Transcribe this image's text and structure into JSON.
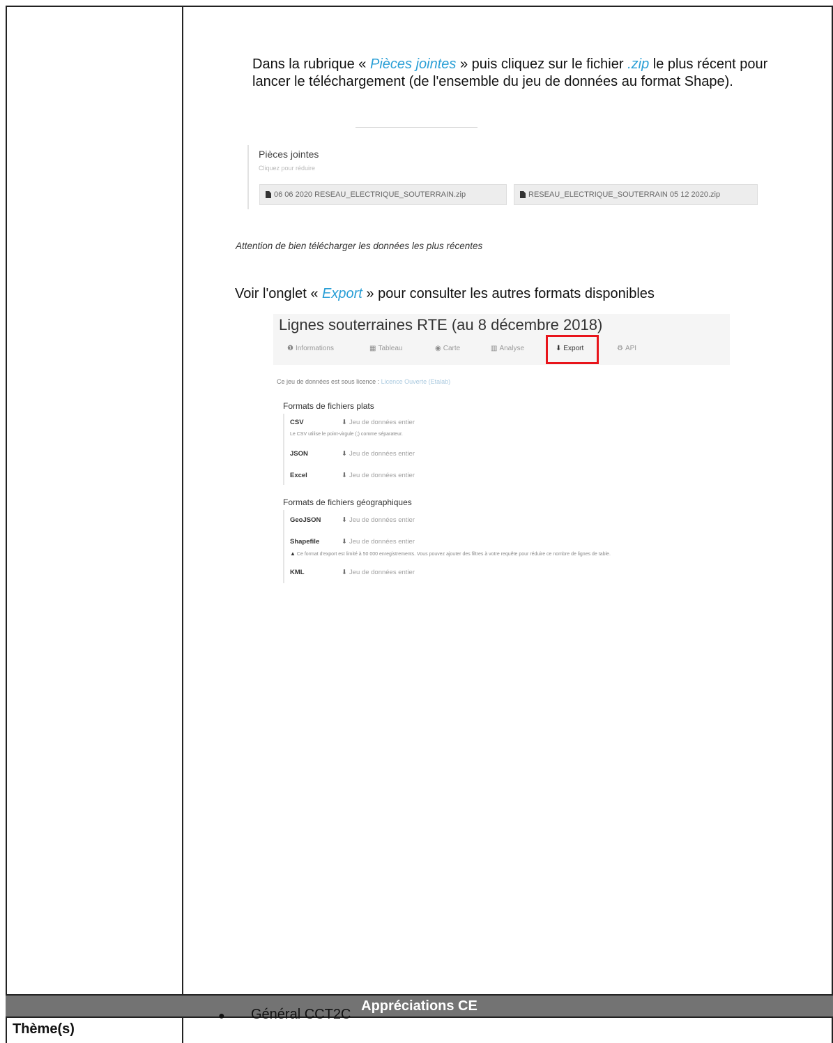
{
  "intro": {
    "part1": "Dans la rubrique « ",
    "pieces": "Pièces jointes",
    "part2": " » puis cliquez sur le fichier ",
    "zip": ".zip",
    "part3": " le plus récent pour lancer le téléchargement (de l'ensemble du jeu de données au format Shape)."
  },
  "attachments": {
    "title": "Pièces jointes",
    "subtitle": "Cliquez pour réduire",
    "files": [
      "06 06 2020 RESEAU_ELECTRIQUE_SOUTERRAIN.zip",
      "RESEAU_ELECTRIQUE_SOUTERRAIN 05 12 2020.zip"
    ]
  },
  "note_recent": "Attention de bien télécharger les données les plus récentes",
  "see_export": {
    "part1": "Voir l'onglet « ",
    "export": "Export",
    "part2": " » pour consulter les autres formats disponibles"
  },
  "portal": {
    "title": "Lignes souterraines RTE (au 8 décembre 2018)",
    "tabs": [
      {
        "icon": "info-icon",
        "glyph": "❶",
        "label": "Informations"
      },
      {
        "icon": "table-icon",
        "glyph": "▦",
        "label": "Tableau"
      },
      {
        "icon": "map-icon",
        "glyph": "◉",
        "label": "Carte"
      },
      {
        "icon": "chart-icon",
        "glyph": "▥",
        "label": "Analyse"
      },
      {
        "icon": "download-icon",
        "glyph": "⬇",
        "label": "Export"
      },
      {
        "icon": "api-icon",
        "glyph": "⚙",
        "label": "API"
      }
    ],
    "license_text": "Ce jeu de données est sous licence : ",
    "license_link": "Licence Ouverte (Etalab)",
    "flat_title": "Formats de fichiers plats",
    "geo_title": "Formats de fichiers géographiques",
    "download_label": "Jeu de données entier",
    "flat_formats": [
      "CSV",
      "JSON",
      "Excel"
    ],
    "csv_note": "Le CSV utilise le point-virgule (;) comme séparateur.",
    "geo_formats": [
      "GeoJSON",
      "Shapefile",
      "KML"
    ],
    "shapefile_note": "Ce format d'export est limité à 50 000 enregistrements. Vous pouvez ajouter des filtres à votre requête pour réduire ce nombre de lignes de table."
  },
  "section_header": "Appréciations CE",
  "theme": {
    "label": "Thème(s)",
    "items": [
      "Général CCT2C"
    ]
  }
}
